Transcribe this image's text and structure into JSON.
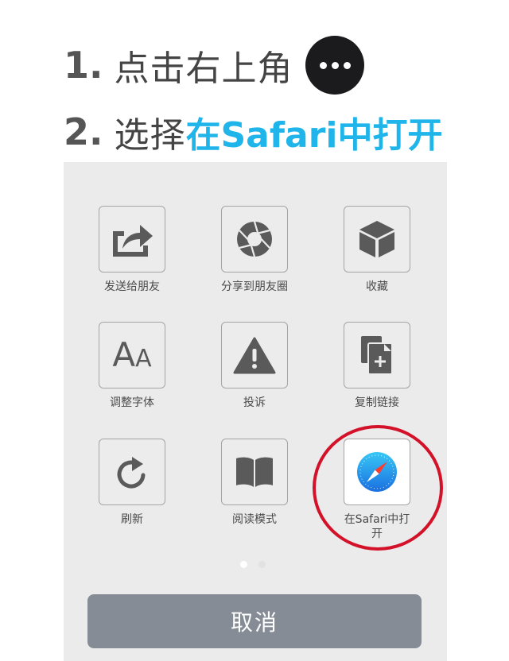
{
  "instructions": {
    "step1": {
      "number": "1.",
      "text": "点击右上角"
    },
    "step2": {
      "number": "2.",
      "text": "选择",
      "highlight": "在Safari中打开"
    }
  },
  "menu": {
    "items": [
      {
        "label": "发送给朋友",
        "icon": "share-arrow-icon"
      },
      {
        "label": "分享到朋友圈",
        "icon": "aperture-icon"
      },
      {
        "label": "收藏",
        "icon": "cube-icon"
      },
      {
        "label": "调整字体",
        "icon": "font-size-icon"
      },
      {
        "label": "投诉",
        "icon": "warning-icon"
      },
      {
        "label": "复制链接",
        "icon": "copy-link-icon"
      },
      {
        "label": "刷新",
        "icon": "refresh-icon"
      },
      {
        "label": "阅读模式",
        "icon": "book-icon"
      },
      {
        "label": "在Safari中打开",
        "icon": "safari-compass-icon"
      }
    ],
    "font_icon_text": "AA",
    "pagination": {
      "active_page": 1,
      "total_pages": 2
    },
    "cancel_label": "取消"
  },
  "colors": {
    "highlight": "#1fb4ea",
    "icon": "#5a5a5a",
    "cancel_bg": "#868c96",
    "circle_mark": "#d3122a",
    "sheet_bg": "#ebebeb"
  }
}
